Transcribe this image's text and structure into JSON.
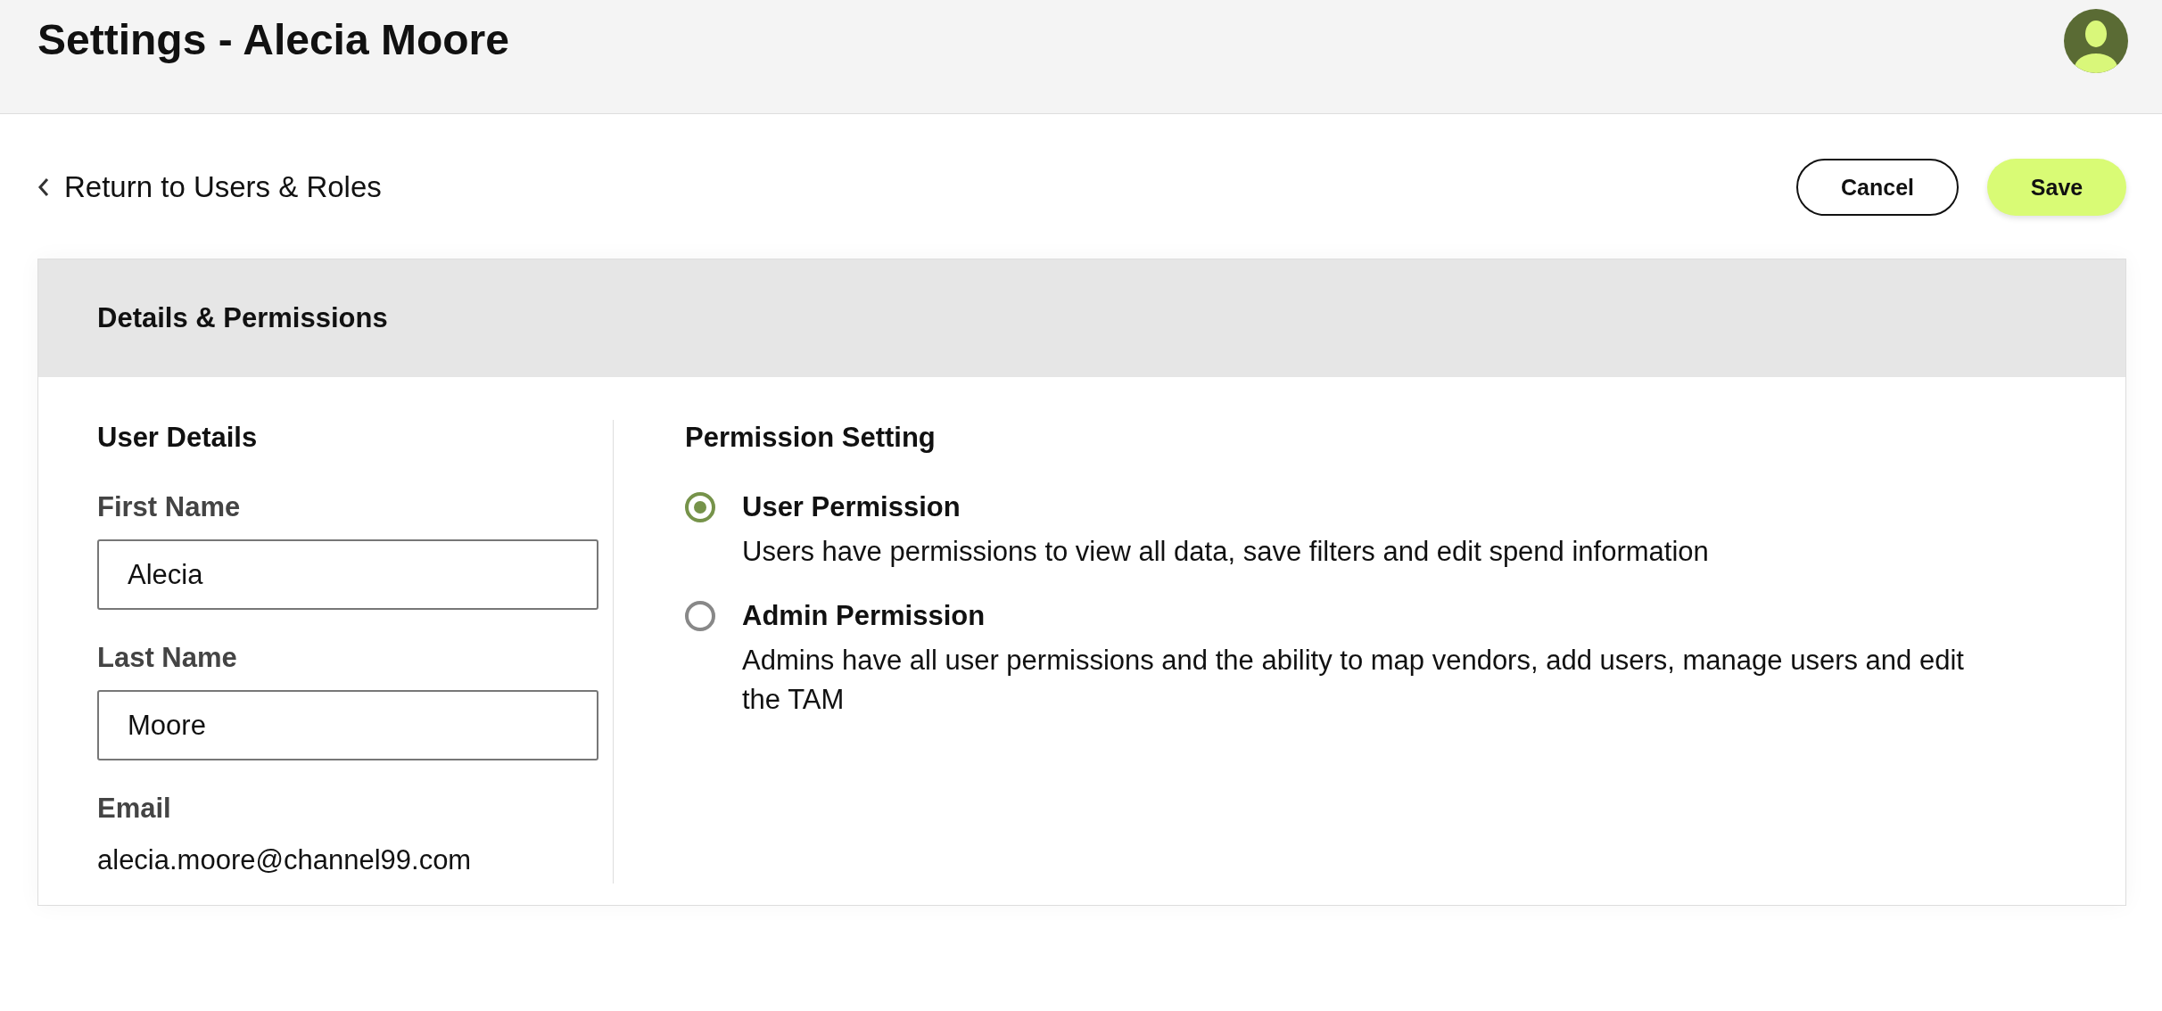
{
  "header": {
    "title": "Settings - Alecia Moore"
  },
  "back_link": {
    "label": "Return to Users & Roles"
  },
  "actions": [
    {
      "label": "Cancel",
      "kind": "secondary"
    },
    {
      "label": "Save",
      "kind": "primary"
    }
  ],
  "card": {
    "title": "Details & Permissions",
    "user_details": {
      "heading": "User Details",
      "fields": [
        {
          "label": "First Name",
          "value": "Alecia"
        },
        {
          "label": "Last Name",
          "value": "Moore"
        }
      ],
      "email": {
        "label": "Email",
        "value": "alecia.moore@channel99.com"
      }
    },
    "permission_setting": {
      "heading": "Permission Setting",
      "options": [
        {
          "label": "User Permission",
          "description": "Users have permissions to view all data, save filters and edit spend information",
          "selected": true
        },
        {
          "label": "Admin Permission",
          "description": "Admins have all user permissions and the ability to map vendors, add users, manage users and edit the TAM",
          "selected": false
        }
      ]
    }
  }
}
